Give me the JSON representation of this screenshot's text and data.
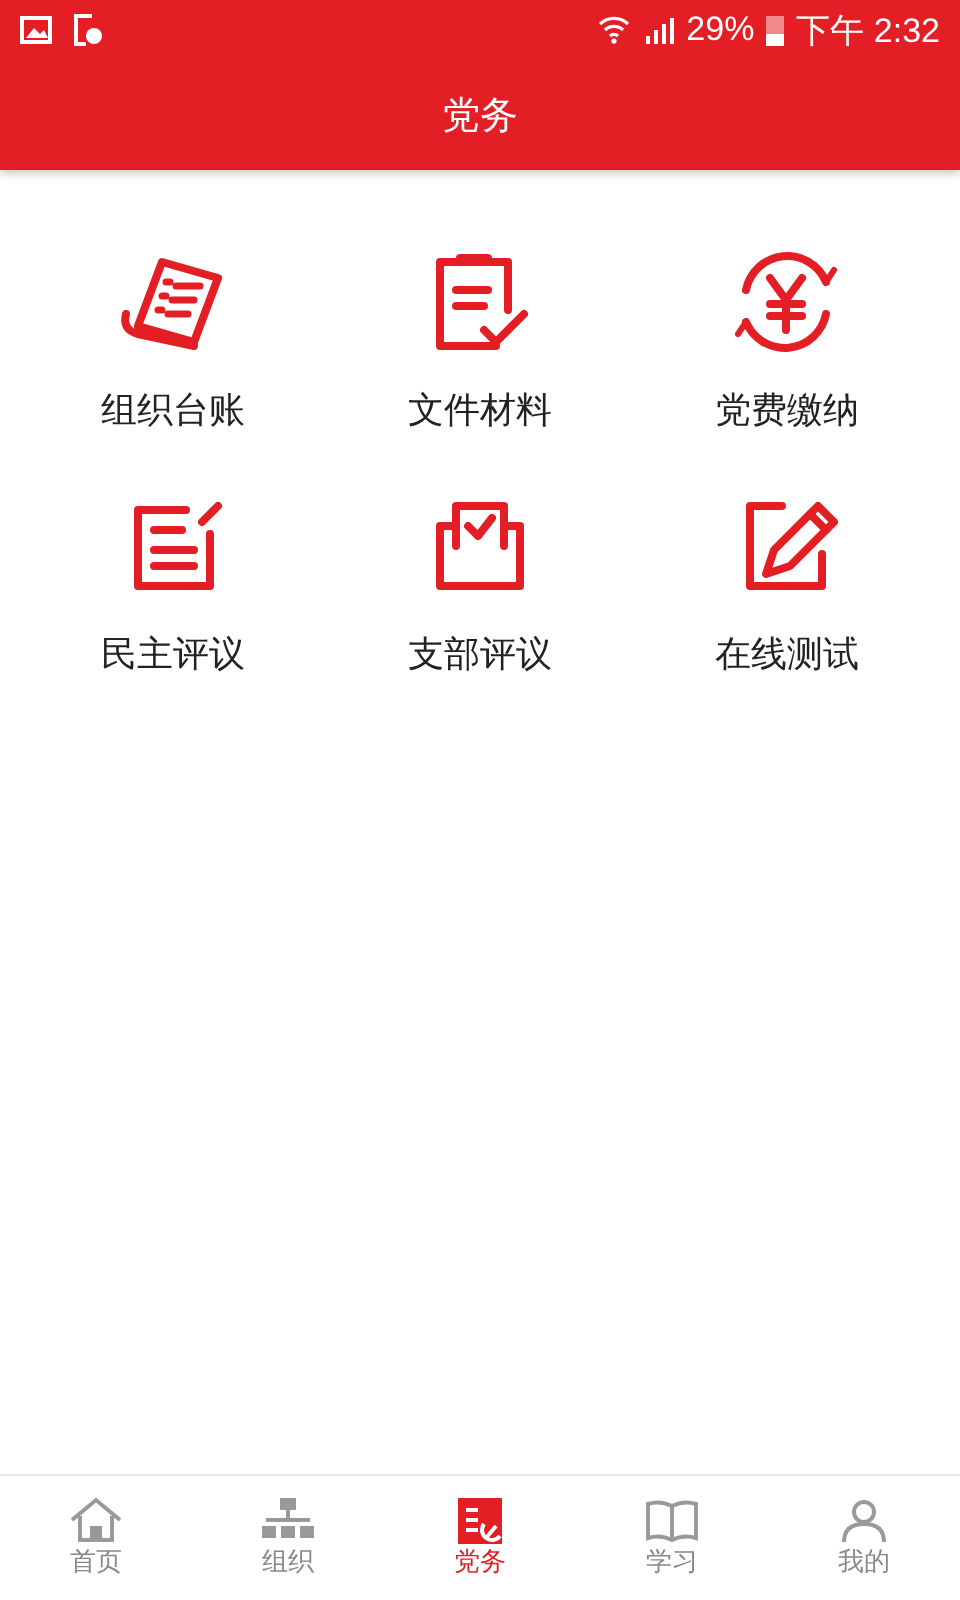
{
  "status_bar": {
    "battery": "29%",
    "time": "下午 2:32"
  },
  "header": {
    "title": "党务"
  },
  "menu": [
    {
      "label": "组织台账"
    },
    {
      "label": "文件材料"
    },
    {
      "label": "党费缴纳"
    },
    {
      "label": "民主评议"
    },
    {
      "label": "支部评议"
    },
    {
      "label": "在线测试"
    }
  ],
  "tab_bar": [
    {
      "label": "首页",
      "selected": false
    },
    {
      "label": "组织",
      "selected": false
    },
    {
      "label": "党务",
      "selected": true
    },
    {
      "label": "学习",
      "selected": false
    },
    {
      "label": "我的",
      "selected": false
    }
  ]
}
